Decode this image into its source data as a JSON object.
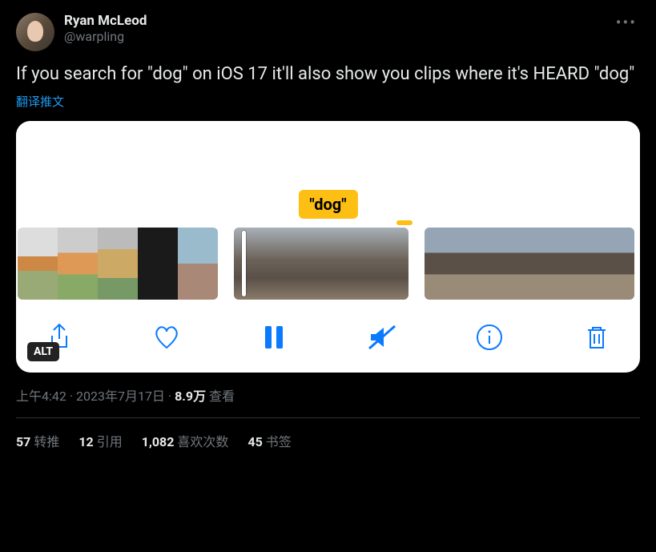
{
  "author": {
    "display_name": "Ryan McLeod",
    "handle": "@warpling"
  },
  "tweet_text": "If you search for \"dog\" on iOS 17 it'll also show you clips where it's HEARD \"dog\"",
  "translate_label": "翻译推文",
  "media": {
    "badge_text": "\"dog\"",
    "alt_label": "ALT"
  },
  "meta": {
    "time": "上午4:42",
    "date": "2023年7月17日",
    "views_count": "8.9万",
    "views_label": "查看"
  },
  "stats": {
    "retweets_count": "57",
    "retweets_label": "转推",
    "quotes_count": "12",
    "quotes_label": "引用",
    "likes_count": "1,082",
    "likes_label": "喜欢次数",
    "bookmarks_count": "45",
    "bookmarks_label": "书签"
  }
}
